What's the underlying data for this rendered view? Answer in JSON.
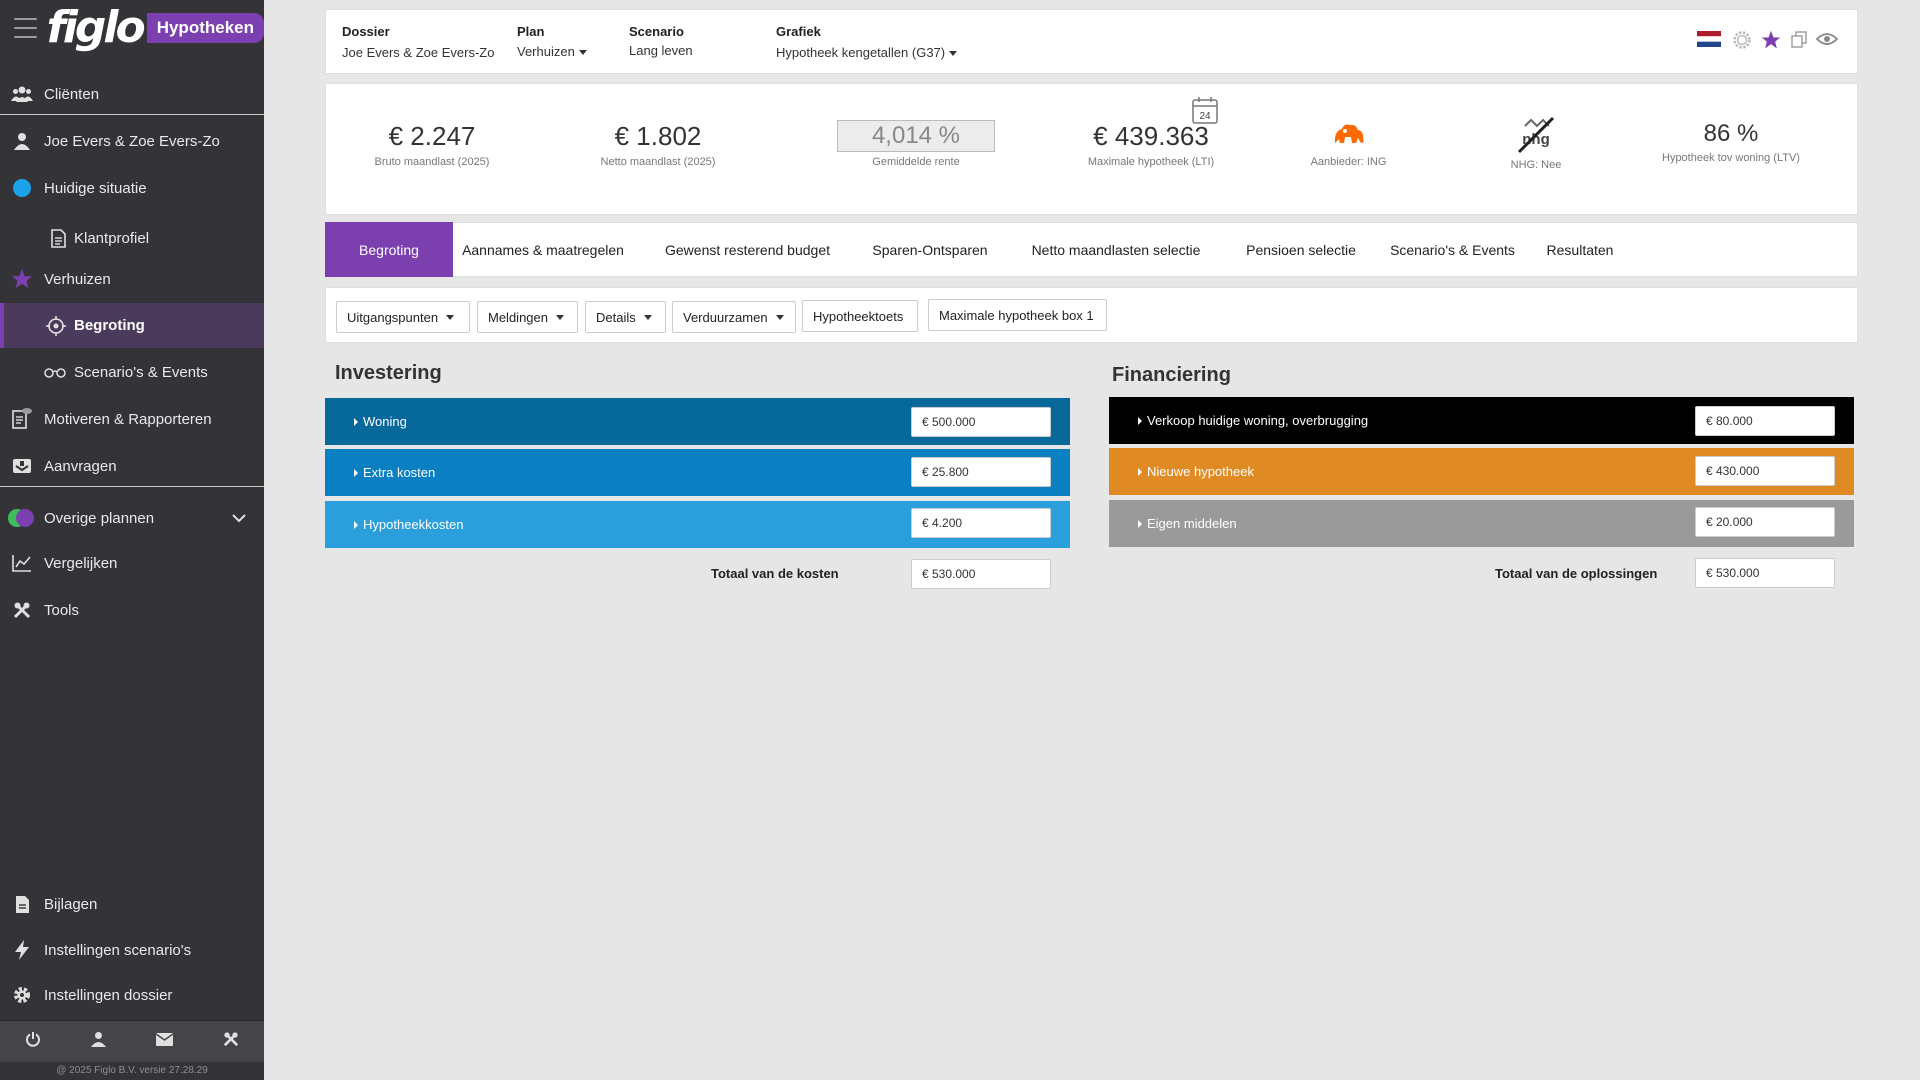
{
  "brand": {
    "logo": "figlo",
    "product": "Hypotheken"
  },
  "sidebar": {
    "items": [
      {
        "label": "Cliënten",
        "icon": "users-icon"
      },
      {
        "label": "Joe Evers & Zoe Evers-Zo",
        "icon": "user-icon"
      },
      {
        "label": "Huidige situatie",
        "icon": "blue-dot-icon"
      },
      {
        "label": "Klantprofiel",
        "icon": "document-icon"
      },
      {
        "label": "Verhuizen",
        "icon": "star-icon"
      },
      {
        "label": "Begroting",
        "icon": "target-icon"
      },
      {
        "label": "Scenario's & Events",
        "icon": "glasses-icon"
      },
      {
        "label": "Motiveren & Rapporteren",
        "icon": "report-icon"
      },
      {
        "label": "Aanvragen",
        "icon": "inbox-icon"
      },
      {
        "label": "Overige plannen",
        "icon": "plans-icon"
      },
      {
        "label": "Vergelijken",
        "icon": "chart-line-icon"
      },
      {
        "label": "Tools",
        "icon": "tools-icon"
      },
      {
        "label": "Bijlagen",
        "icon": "file-icon"
      },
      {
        "label": "Instellingen scenario's",
        "icon": "bolt-icon"
      },
      {
        "label": "Instellingen dossier",
        "icon": "gear-icon"
      }
    ],
    "copyright": "@ 2025 Figlo B.V. versie 27.28.29"
  },
  "header": {
    "dossier_label": "Dossier",
    "dossier_value": "Joe Evers & Zoe Evers-Zo",
    "plan_label": "Plan",
    "plan_value": "Verhuizen",
    "scenario_label": "Scenario",
    "scenario_value": "Lang leven",
    "grafiek_label": "Grafiek",
    "grafiek_value": "Hypotheek kengetallen (G37)"
  },
  "kpis": {
    "bruto_value": "€ 2.247",
    "bruto_label": "Bruto maandlast (2025)",
    "netto_value": "€ 1.802",
    "netto_label": "Netto maandlast (2025)",
    "rente_value": "4,014 %",
    "rente_label": "Gemiddelde rente",
    "max_value": "€ 439.363",
    "max_label": "Maximale hypotheek (LTI)",
    "calendar_day": "24",
    "aanbieder_label": "Aanbieder: ING",
    "nhg_label": "NHG: Nee",
    "nhg_logo": "nhg",
    "ltv_value": "86 %",
    "ltv_label": "Hypotheek tov woning (LTV)"
  },
  "tabs": [
    "Begroting",
    "Aannames & maatregelen",
    "Gewenst resterend budget",
    "Sparen-Ontsparen",
    "Netto maandlasten selectie",
    "Pensioen selectie",
    "Scenario's & Events",
    "Resultaten"
  ],
  "toolbar": {
    "uitgangspunten": "Uitgangspunten",
    "meldingen": "Meldingen",
    "details": "Details",
    "verduurzamen": "Verduurzamen",
    "hypotheektoets": "Hypotheektoets",
    "max_box1": "Maximale hypotheek box 1"
  },
  "investering": {
    "title": "Investering",
    "rows": [
      {
        "label": "Woning",
        "value": "€ 500.000",
        "color": "#06689b"
      },
      {
        "label": "Extra kosten",
        "value": "€ 25.800",
        "color": "#0a7fc1"
      },
      {
        "label": "Hypotheekkosten",
        "value": "€ 4.200",
        "color": "#2a9fdc"
      }
    ],
    "total_label": "Totaal van de kosten",
    "total_value": "€ 530.000"
  },
  "financiering": {
    "title": "Financiering",
    "rows": [
      {
        "label": "Verkoop huidige woning, overbrugging",
        "value": "€ 80.000",
        "color": "#000000"
      },
      {
        "label": "Nieuwe hypotheek",
        "value": "€ 430.000",
        "color": "#e08a24"
      },
      {
        "label": "Eigen middelen",
        "value": "€ 20.000",
        "color": "#9a9a9a"
      }
    ],
    "total_label": "Totaal van de oplossingen",
    "total_value": "€ 530.000"
  },
  "colors": {
    "accent": "#7b3fb0",
    "sidebar": "#333338"
  }
}
